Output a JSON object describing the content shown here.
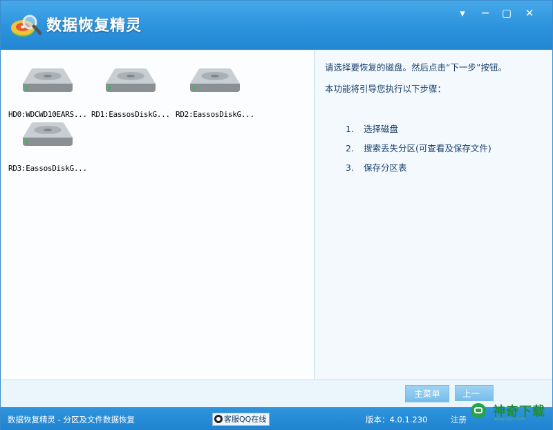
{
  "window": {
    "title": "数据恢复精灵"
  },
  "title_buttons": {
    "menu": "▾",
    "minimize": "—",
    "maximize": "▢",
    "close": "✕"
  },
  "disks": [
    {
      "label": "HD0:WDCWD10EARS..."
    },
    {
      "label": "RD1:EassosDiskG..."
    },
    {
      "label": "RD2:EassosDiskG..."
    },
    {
      "label": "RD3:EassosDiskG..."
    }
  ],
  "info": {
    "instruction": "请选择要恢复的磁盘。然后点击“下一步”按钮。",
    "intro": "本功能将引导您执行以下步骤：",
    "steps": [
      {
        "num": "1.",
        "text": "选择磁盘"
      },
      {
        "num": "2.",
        "text": "搜索丢失分区(可查看及保存文件)"
      },
      {
        "num": "3.",
        "text": "保存分区表"
      }
    ]
  },
  "buttons": {
    "main_menu": "主菜单",
    "prev": "上一"
  },
  "statusbar": {
    "app_desc": "数据恢复精灵 - 分区及文件数据恢复",
    "qq": "客服QQ在线",
    "version": "版本：4.0.1.230",
    "register": "注册"
  },
  "watermark": {
    "text": "神奇下载",
    "url": "www.sqxz.com"
  },
  "colors": {
    "title_bar": "#2b92dd",
    "status_bar": "#1f83cf",
    "text": "#1a3f6a",
    "button": "#8ccbf0"
  }
}
